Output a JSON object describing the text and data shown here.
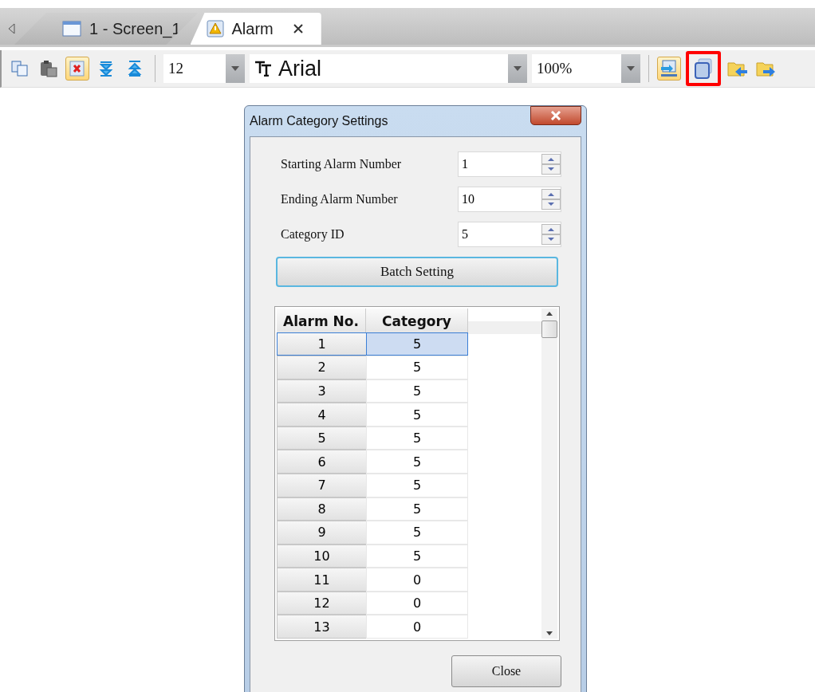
{
  "tabs": [
    {
      "label": "1 - Screen_1",
      "kind": "screen",
      "selected": false
    },
    {
      "label": "Alarm",
      "kind": "alarm",
      "selected": true
    }
  ],
  "toolbar": {
    "left_icons": [
      {
        "kind": "copy",
        "pressed": false,
        "marked": false
      },
      {
        "kind": "paste",
        "pressed": false,
        "marked": false
      },
      {
        "kind": "delete",
        "pressed": true,
        "marked": false
      },
      {
        "kind": "down",
        "pressed": false,
        "marked": false
      },
      {
        "kind": "up",
        "pressed": false,
        "marked": false
      }
    ],
    "font_size": "12",
    "font_name": "Arial",
    "zoom": "100%",
    "right_icons": [
      {
        "kind": "import",
        "pressed": true,
        "marked": false
      },
      {
        "kind": "layers",
        "pressed": false,
        "marked": true
      },
      {
        "kind": "folder-left",
        "pressed": false,
        "marked": false
      },
      {
        "kind": "folder-right",
        "pressed": false,
        "marked": false
      }
    ]
  },
  "dialog": {
    "title": "Alarm Category Settings",
    "fields": [
      {
        "label": "Starting Alarm Number",
        "value": "1"
      },
      {
        "label": "Ending Alarm Number",
        "value": "10"
      },
      {
        "label": "Category ID",
        "value": "5"
      }
    ],
    "batch_button": "Batch Setting",
    "table": {
      "columns": [
        "Alarm No.",
        "Category"
      ],
      "rows": [
        {
          "no": "1",
          "category": "5",
          "selected": true
        },
        {
          "no": "2",
          "category": "5",
          "selected": false
        },
        {
          "no": "3",
          "category": "5",
          "selected": false
        },
        {
          "no": "4",
          "category": "5",
          "selected": false
        },
        {
          "no": "5",
          "category": "5",
          "selected": false
        },
        {
          "no": "6",
          "category": "5",
          "selected": false
        },
        {
          "no": "7",
          "category": "5",
          "selected": false
        },
        {
          "no": "8",
          "category": "5",
          "selected": false
        },
        {
          "no": "9",
          "category": "5",
          "selected": false
        },
        {
          "no": "10",
          "category": "5",
          "selected": false
        },
        {
          "no": "11",
          "category": "0",
          "selected": false
        },
        {
          "no": "12",
          "category": "0",
          "selected": false
        },
        {
          "no": "13",
          "category": "0",
          "selected": false
        }
      ]
    },
    "close_button": "Close"
  }
}
